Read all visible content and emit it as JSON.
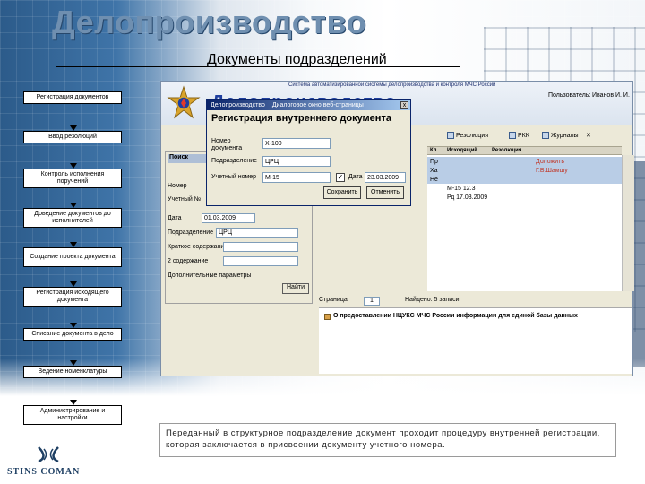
{
  "slide": {
    "heading": "Делопроизводство",
    "subtitle": "Документы подразделений"
  },
  "flow": [
    "Регистрация документов",
    "Ввод резолюций",
    "Контроль исполнения поручений",
    "Доведение документов до исполнителей",
    "Создание проекта документа",
    "Регистрация исходящего документа",
    "Списание документа в дело",
    "Ведение номенклатуры",
    "Администрирование и настройки"
  ],
  "app": {
    "system_title": "Система автоматизированной системы делопроизводства и контроля МЧС России",
    "title": "Делопроизводство",
    "user_label": "Пользователь:",
    "user_name": "Иванов И. И.",
    "toolbar": {
      "resolution": "Резолюция",
      "rkk": "РКК",
      "journals": "Журналы"
    },
    "grid_headers": {
      "kl": "Кл",
      "outgoing": "Исходящий",
      "resolution": "Резолюция"
    },
    "rows": [
      {
        "kl": "Пр",
        "outgoing": "",
        "resolution": "Доложить"
      },
      {
        "kl": "Ха",
        "outgoing": "",
        "resolution": "Г.В.Шамшу"
      },
      {
        "kl": "Не",
        "outgoing": "",
        "resolution": ""
      },
      {
        "kl": "",
        "outgoing": "М-15 12.3",
        "resolution": ""
      },
      {
        "kl": "",
        "outgoing": "Рд 17.03.2009",
        "resolution": ""
      }
    ],
    "pager": {
      "page_label": "Страница",
      "page": "1",
      "found": "Найдено: 5 записи"
    },
    "notice": "О предоставлении НЦУКС МЧС России информации для единой базы данных",
    "search_form": {
      "title": "Поиск",
      "number_label": "Номер",
      "account_label": "Учетный №",
      "date_label": "Дата",
      "date_value": "01.03.2009",
      "unit_label": "Подразделение",
      "unit_value": "ЦРЦ",
      "content_label": "Краткое содержание",
      "content2_label": "2 содержание",
      "extra_label": "Дополнительные параметры",
      "search_button": "Найти"
    }
  },
  "dialog": {
    "title_left": "Делопроизводство",
    "title_right": "Диалоговое окно веб-страницы",
    "close": "x",
    "heading": "Регистрация внутреннего документа",
    "number_label": "Номер документа",
    "number_value": "Х-100",
    "unit_label": "Подразделение",
    "unit_value": "ЦРЦ",
    "account_label": "Учетный номер",
    "account_value": "М-15",
    "date_label": "Дата",
    "date_value": "23.03.2009",
    "save_button": "Сохранить",
    "cancel_button": "Отменить"
  },
  "caption": "Переданный в структурное подразделение документ проходит процедуру внутренней регистрации, которая заключается в присвоении документу учетного номера.",
  "logo": {
    "text": "STINS COMAN"
  }
}
